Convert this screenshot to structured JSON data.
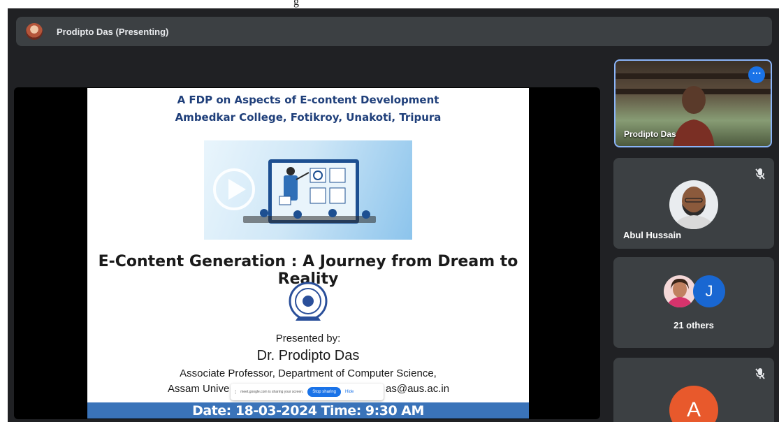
{
  "caption_fragment": "g",
  "presenter_bar": {
    "label": "Prodipto Das (Presenting)"
  },
  "slide": {
    "heading_line1": "A FDP on Aspects of E-content Development",
    "heading_line2": "Ambedkar College, Fotikroy, Unakoti,  Tripura",
    "title": "E-Content Generation : A Journey from Dream to Reality",
    "presented_by": "Presented by:",
    "presenter_name": "Dr. Prodipto Das",
    "designation": "Associate Professor, Department of Computer Science,",
    "institution_prefix": "Assam Unive",
    "email_suffix": "as@aus.ac.in",
    "date_line": "Date: 18-03-2024  Time: 9:30 AM"
  },
  "share_notice": {
    "text": "meet.google.com is sharing your screen.",
    "stop_label": "Stop sharing",
    "hide_label": "Hide"
  },
  "participants": {
    "pinned": {
      "name": "Prodipto Das"
    },
    "tile1": {
      "name": "Abul Hussain"
    },
    "tile2": {
      "initial": "J",
      "label": "21 others"
    },
    "tile3": {
      "initial": "A"
    }
  },
  "colors": {
    "meet_background": "#202124",
    "tile_background": "#3c4043",
    "accent_blue": "#1a73e8",
    "slide_heading": "#1f3f7a",
    "date_band": "#3a73b9"
  }
}
